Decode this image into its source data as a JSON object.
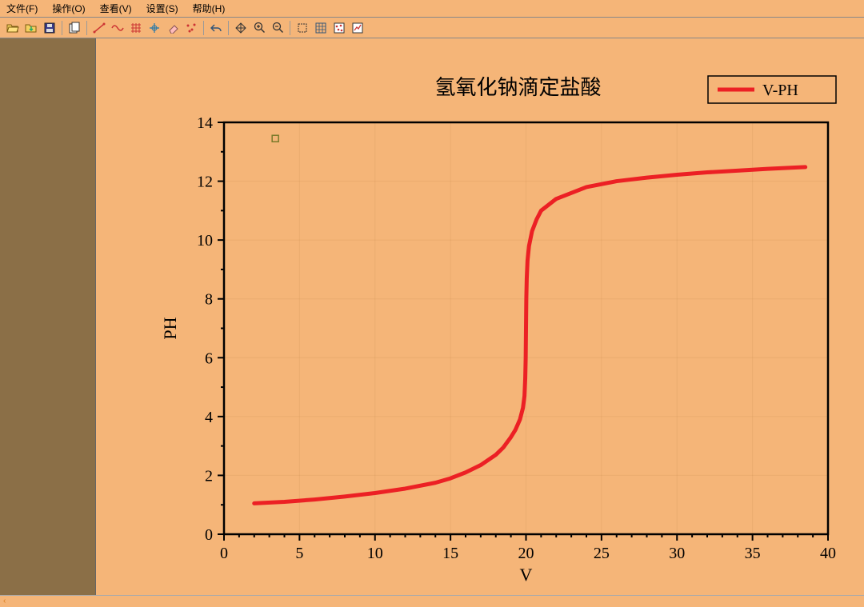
{
  "menu": {
    "file": "文件(F)",
    "operate": "操作(O)",
    "view": "查看(V)",
    "settings": "设置(S)",
    "help": "帮助(H)"
  },
  "toolbar": {
    "icons": [
      "open-icon",
      "import-icon",
      "save-icon",
      "sep",
      "copy-icon",
      "sep",
      "draw-line-icon",
      "wave-icon",
      "grid-lines-icon",
      "crosshair-icon",
      "eraser-icon",
      "scatter-icon",
      "sep",
      "undo-icon",
      "sep",
      "pan-icon",
      "zoom-in-icon",
      "zoom-out-icon",
      "sep",
      "select-icon",
      "grid-icon",
      "points-icon",
      "chart-icon"
    ]
  },
  "chart_data": {
    "type": "line",
    "title": "氢氧化钠滴定盐酸",
    "xlabel": "V",
    "ylabel": "PH",
    "xlim": [
      0,
      40
    ],
    "ylim": [
      0,
      14
    ],
    "xticks": [
      0,
      5,
      10,
      15,
      20,
      25,
      30,
      35,
      40
    ],
    "yticks": [
      0,
      2,
      4,
      6,
      8,
      10,
      12,
      14
    ],
    "legend": {
      "label": "V-PH"
    },
    "series": [
      {
        "name": "V-PH",
        "x": [
          2,
          4,
          6,
          8,
          10,
          12,
          14,
          15,
          16,
          17,
          18,
          18.5,
          19,
          19.3,
          19.6,
          19.8,
          19.9,
          19.95,
          19.98,
          20,
          20.02,
          20.05,
          20.1,
          20.2,
          20.4,
          20.7,
          21,
          22,
          24,
          26,
          28,
          30,
          32,
          34,
          36,
          38.5
        ],
        "y": [
          1.05,
          1.1,
          1.18,
          1.28,
          1.4,
          1.55,
          1.75,
          1.9,
          2.1,
          2.35,
          2.7,
          2.95,
          3.3,
          3.55,
          3.9,
          4.3,
          4.7,
          5.3,
          6.0,
          7.0,
          8.0,
          8.7,
          9.3,
          9.8,
          10.3,
          10.7,
          11.0,
          11.4,
          11.8,
          12.0,
          12.12,
          12.22,
          12.3,
          12.36,
          12.42,
          12.48
        ]
      }
    ],
    "marker_point": {
      "x": 3.4,
      "y": 13.45
    }
  },
  "status": {
    "indicator": "‹"
  },
  "colors": {
    "accent": "#ec2024",
    "panel": "#f5b578",
    "sidebar": "#8b6f47"
  }
}
